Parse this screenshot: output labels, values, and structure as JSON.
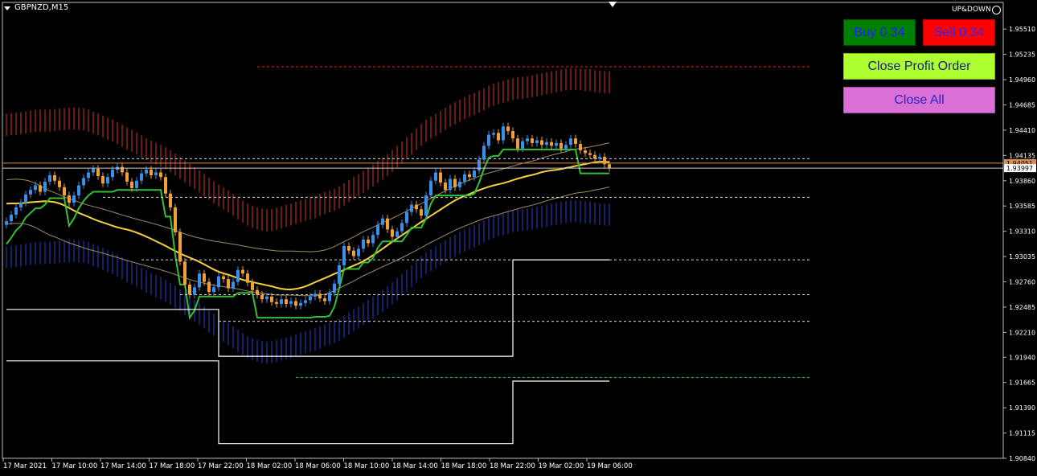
{
  "header": {
    "symbol": "GBPNZD,M15",
    "indicator_label": "UP&DOWN"
  },
  "buttons": {
    "buy": "Buy 0.34",
    "sell": "Sell 0.34",
    "close_profit": "Close Profit Order",
    "close_all": "Close All"
  },
  "colors": {
    "background": "#000000",
    "bull_candle": "#3a8fe8",
    "bear_candle": "#f0a038",
    "upper_band": "#d9352b",
    "lower_band": "#2a3fd0",
    "support_line": "#34c034",
    "ma_yellow": "#f5d23c",
    "ma_tan": "#a08d66",
    "level_white": "#ffffff",
    "price_line": "#d98c52"
  },
  "chart_data": {
    "type": "candlestick",
    "symbol": "GBPNZD",
    "timeframe": "M15",
    "ylim": [
      1.9084,
      1.958
    ],
    "y_ticks": [
      "1.95510",
      "1.95235",
      "1.94960",
      "1.94685",
      "1.94410",
      "1.94135",
      "1.93860",
      "1.93585",
      "1.93310",
      "1.93035",
      "1.92760",
      "1.92485",
      "1.92210",
      "1.91940",
      "1.91665",
      "1.91390",
      "1.91115",
      "1.90840"
    ],
    "x_tick_labels": [
      "17 Mar 2021",
      "17 Mar 10:00",
      "17 Mar 14:00",
      "17 Mar 18:00",
      "17 Mar 22:00",
      "18 Mar 02:00",
      "18 Mar 06:00",
      "18 Mar 10:00",
      "18 Mar 14:00",
      "18 Mar 18:00",
      "18 Mar 22:00",
      "19 Mar 02:00",
      "19 Mar 06:00"
    ],
    "price_labels": {
      "bid": "1.94051",
      "current": "1.93997"
    },
    "close_series": [
      1.9342,
      1.9349,
      1.9357,
      1.9362,
      1.9371,
      1.9376,
      1.9381,
      1.9374,
      1.9385,
      1.9392,
      1.9386,
      1.9379,
      1.937,
      1.9362,
      1.937,
      1.9381,
      1.9389,
      1.9395,
      1.9399,
      1.9391,
      1.9383,
      1.939,
      1.9398,
      1.9401,
      1.9395,
      1.9385,
      1.9378,
      1.9386,
      1.9394,
      1.9398,
      1.9392,
      1.9395,
      1.939,
      1.9372,
      1.9357,
      1.933,
      1.9298,
      1.9273,
      1.9262,
      1.927,
      1.9285,
      1.9276,
      1.9265,
      1.927,
      1.9282,
      1.9279,
      1.9269,
      1.9276,
      1.9289,
      1.9285,
      1.9275,
      1.9267,
      1.9262,
      1.9257,
      1.926,
      1.9254,
      1.9252,
      1.9257,
      1.9252,
      1.9255,
      1.925,
      1.9253,
      1.9256,
      1.926,
      1.9263,
      1.9258,
      1.9255,
      1.9264,
      1.9274,
      1.9294,
      1.9315,
      1.931,
      1.9304,
      1.9312,
      1.9322,
      1.9318,
      1.9327,
      1.9338,
      1.9345,
      1.9333,
      1.9325,
      1.9331,
      1.934,
      1.9352,
      1.936,
      1.9355,
      1.9348,
      1.937,
      1.9386,
      1.9395,
      1.9384,
      1.9376,
      1.9388,
      1.9379,
      1.9385,
      1.9393,
      1.939,
      1.9397,
      1.9409,
      1.9424,
      1.9436,
      1.9438,
      1.943,
      1.9445,
      1.944,
      1.9432,
      1.9421,
      1.9429,
      1.9432,
      1.9427,
      1.943,
      1.9425,
      1.9428,
      1.9424,
      1.9427,
      1.9421,
      1.9425,
      1.9432,
      1.9426,
      1.9419,
      1.9416,
      1.9414,
      1.941,
      1.9412,
      1.9404,
      1.94
    ]
  }
}
